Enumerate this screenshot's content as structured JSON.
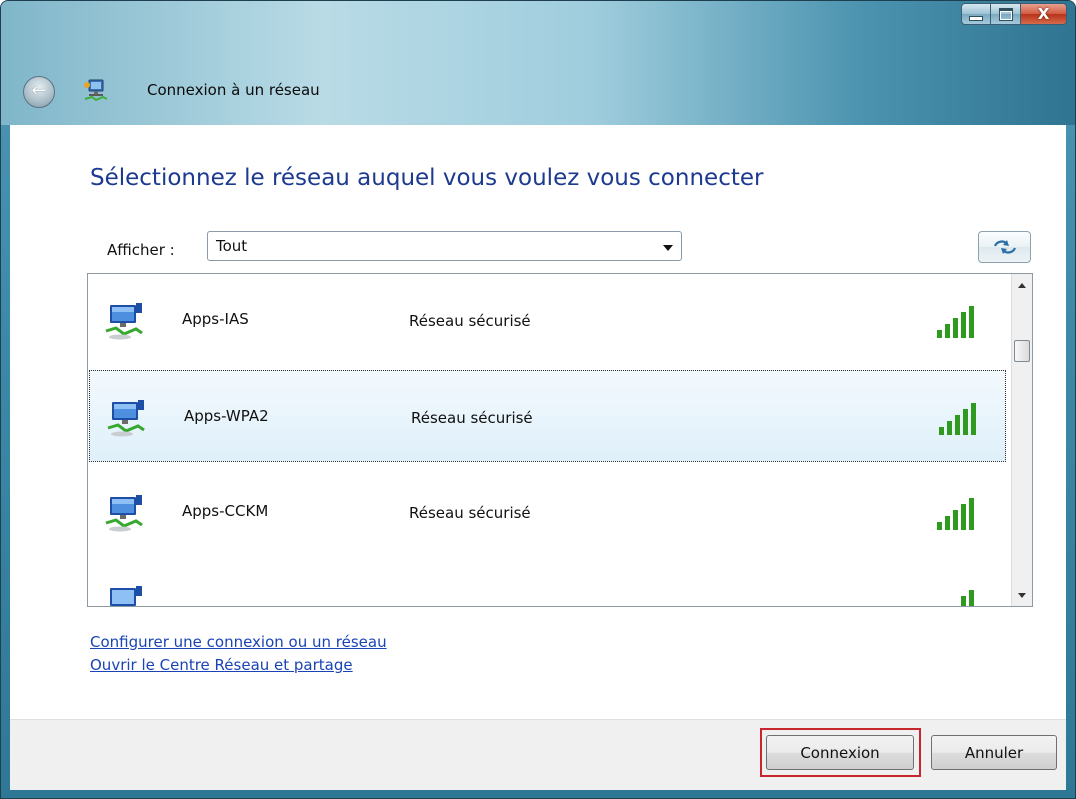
{
  "window": {
    "title": "Connexion à un réseau",
    "caption_buttons": {
      "close_label": "X"
    }
  },
  "main": {
    "heading": "Sélectionnez le réseau auquel vous voulez vous connecter",
    "show_label": "Afficher :",
    "show_value": "Tout"
  },
  "networks": [
    {
      "name": "Apps-IAS",
      "status": "Réseau sécurisé",
      "selected": false,
      "signal_bars": 5
    },
    {
      "name": "Apps-WPA2",
      "status": "Réseau sécurisé",
      "selected": true,
      "signal_bars": 5
    },
    {
      "name": "Apps-CCKM",
      "status": "Réseau sécurisé",
      "selected": false,
      "signal_bars": 5
    }
  ],
  "links": {
    "setup": "Configurer une connexion ou un réseau",
    "network_center": "Ouvrir le Centre Réseau et partage"
  },
  "footer": {
    "connect": "Connexion",
    "cancel": "Annuler"
  },
  "colors": {
    "heading": "#1c3a8f",
    "link": "#1a44b5",
    "selection_outline": "#c8262e",
    "signal_green": "#2f9a1f"
  },
  "icons": {
    "back": "back-arrow-icon",
    "title": "network-connection-icon",
    "network": "wireless-network-icon",
    "signal": "signal-strength-icon",
    "refresh": "refresh-icon"
  }
}
